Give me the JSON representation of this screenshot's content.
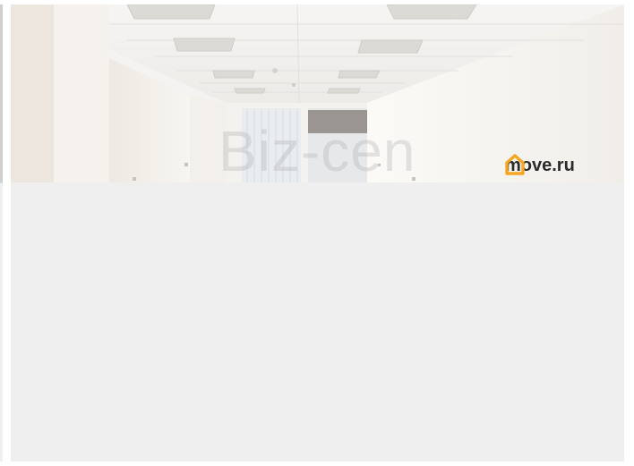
{
  "listing": {
    "photo": {
      "scene": "office-interior-photo",
      "watermark_text": "Biz-cen",
      "logo_text": "move.ru",
      "logo_icon": "house-icon",
      "logo_icon_color": "#f5a623"
    },
    "background_color": "#efefef"
  }
}
